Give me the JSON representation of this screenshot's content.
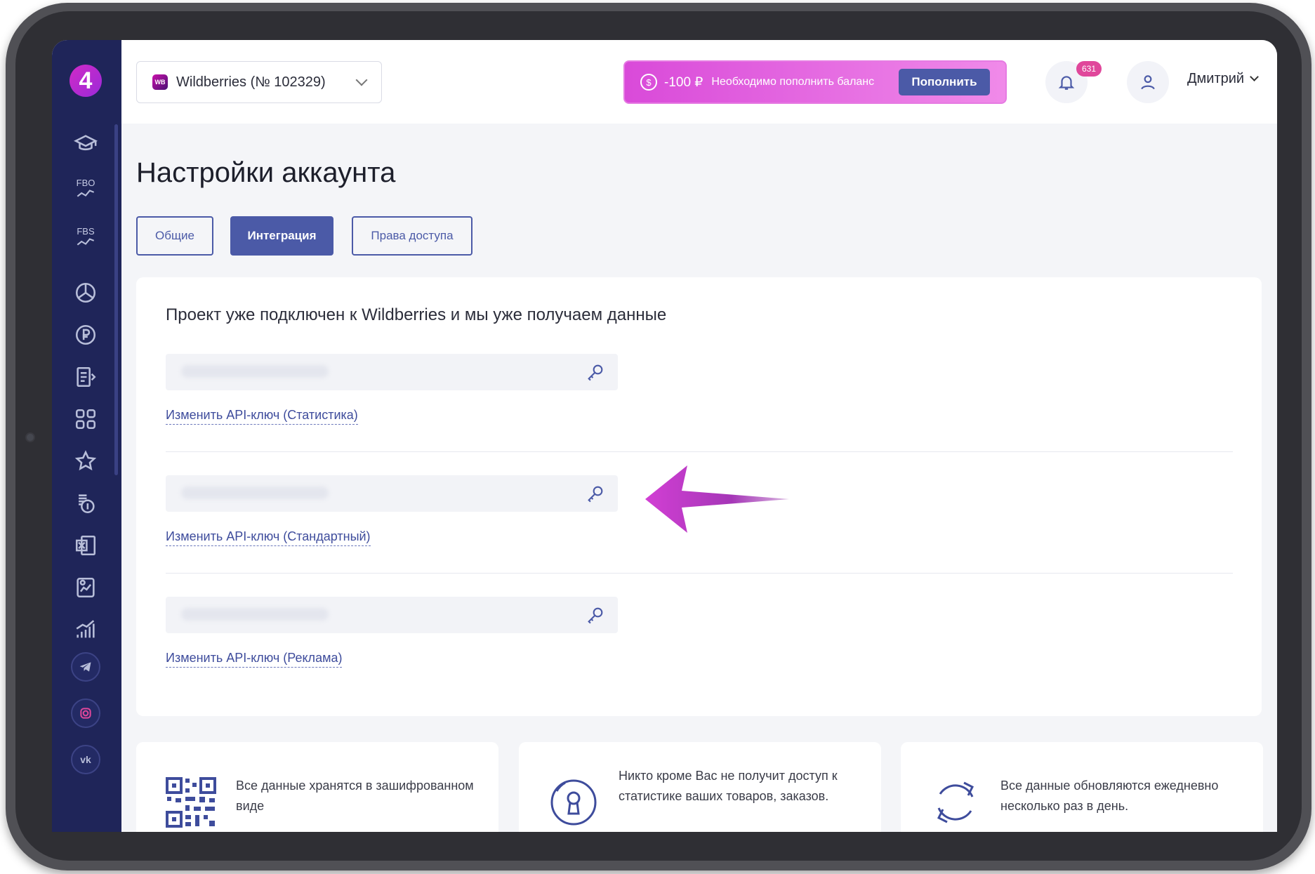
{
  "header": {
    "shop_badge": "WB",
    "shop_select": "Wildberries (№ 102329)",
    "balance_amount": "-100 ₽",
    "balance_currency_icon": "$",
    "balance_text": "Необходимо пополнить баланс",
    "topup_label": "Пополнить",
    "notifications_count": "631",
    "user_name": "Дмитрий"
  },
  "sidebar": {
    "logo": "4",
    "items": [
      {
        "icon": "graduation-cap-icon"
      },
      {
        "icon": "fbo-chart-icon",
        "label": "FBO"
      },
      {
        "icon": "fbs-chart-icon",
        "label": "FBS"
      },
      {
        "icon": "pie-chart-icon"
      },
      {
        "icon": "ruble-coin-icon"
      },
      {
        "icon": "checklist-icon"
      },
      {
        "icon": "apps-grid-icon"
      },
      {
        "icon": "star-icon"
      },
      {
        "icon": "coins-icon"
      },
      {
        "icon": "excel-icon"
      },
      {
        "icon": "report-chart-icon"
      },
      {
        "icon": "bar-growth-icon"
      }
    ],
    "social": [
      {
        "icon": "telegram-icon"
      },
      {
        "icon": "instagram-icon"
      },
      {
        "icon": "vk-icon",
        "label": "vk"
      }
    ]
  },
  "page": {
    "title": "Настройки аккаунта",
    "tabs": [
      {
        "label": "Общие",
        "active": false
      },
      {
        "label": "Интеграция",
        "active": true
      },
      {
        "label": "Права доступа",
        "active": false
      }
    ]
  },
  "integration": {
    "status_text": "Проект уже подключен к Wildberries и мы уже получаем данные",
    "keys": [
      {
        "link": "Изменить API-ключ (Статистика)"
      },
      {
        "link": "Изменить API-ключ (Стандартный)"
      },
      {
        "link": "Изменить API-ключ (Реклама)"
      }
    ]
  },
  "info_cards": [
    {
      "icon": "qr-code-icon",
      "text": "Все данные хранятся в зашифрованном виде"
    },
    {
      "icon": "keyhole-icon",
      "text": "Никто кроме Вас не получит доступ к статистике ваших товаров, заказов."
    },
    {
      "icon": "refresh-icon",
      "text": "Все данные обновляются ежедневно несколько раз в день."
    }
  ],
  "colors": {
    "sidebar_bg": "#1f2559",
    "accent": "#4b5aa7",
    "balance_gradient_start": "#d94ad9",
    "balance_gradient_end": "#f08ae9",
    "badge_pink": "#e0479b"
  }
}
